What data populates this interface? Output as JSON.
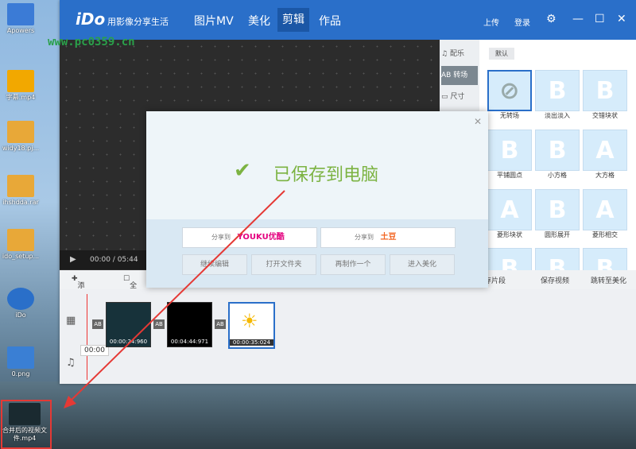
{
  "watermark": "www.pc0359.cn",
  "desktop": {
    "icons": [
      {
        "label": "Apowers",
        "color": "#3b7bd6"
      },
      {
        "label": "字幕.mp4",
        "color": "#f2a800"
      },
      {
        "label": "widy18.pj...",
        "color": "#e8a838"
      },
      {
        "label": "ihshdda.rar",
        "color": "#e8a838"
      },
      {
        "label": "ido_setup...",
        "color": "#e8a838"
      },
      {
        "label": "iDo",
        "color": "#2a6fc9"
      },
      {
        "label": "0.png",
        "color": "#3a7fd4"
      }
    ],
    "highlighted_file": {
      "label": "合并后的视频文件.mp4"
    }
  },
  "app": {
    "logo": "iDo",
    "slogan": "用影像分享生活",
    "tabs": [
      {
        "label": "图片MV",
        "active": false
      },
      {
        "label": "美化",
        "active": false
      },
      {
        "label": "剪辑",
        "active": true
      },
      {
        "label": "作品",
        "active": false
      }
    ],
    "upload": "上传",
    "login": "登录"
  },
  "player": {
    "time": "00:00 / 05:44"
  },
  "side_tools": [
    {
      "label": "配乐",
      "icon": "music-icon",
      "active": false
    },
    {
      "label": "转场",
      "icon": "ab-icon",
      "active": true
    },
    {
      "label": "尺寸",
      "icon": "screen-icon",
      "active": false
    }
  ],
  "transitions": {
    "header": "默认",
    "items": [
      {
        "label": "无转场",
        "glyph": "⊘"
      },
      {
        "label": "淡出淡入",
        "glyph": "B"
      },
      {
        "label": "交错块状",
        "glyph": "B"
      },
      {
        "label": "平铺圆点",
        "glyph": "B"
      },
      {
        "label": "小方格",
        "glyph": "B"
      },
      {
        "label": "大方格",
        "glyph": "A"
      },
      {
        "label": "菱形块状",
        "glyph": "A"
      },
      {
        "label": "圆形展开",
        "glyph": "B"
      },
      {
        "label": "菱形相交",
        "glyph": "A"
      },
      {
        "label": "",
        "glyph": "B"
      },
      {
        "label": "",
        "glyph": "B"
      },
      {
        "label": "",
        "glyph": "B"
      }
    ]
  },
  "toolbar": {
    "add": "添加",
    "select_all": "全选",
    "save_clip": "保存片段",
    "save_video": "保存视频",
    "goto_beautify": "跳转至美化"
  },
  "timeline": {
    "clips": [
      {
        "time": "00:00:24:960"
      },
      {
        "time": "00:04:44:971"
      },
      {
        "time": "00:00:35:024"
      }
    ],
    "transition_label": "AB",
    "audio_time": "00:00"
  },
  "dialog": {
    "message": "已保存到电脑",
    "share1": {
      "prefix": "分享到",
      "brand": "YOUKU优酷"
    },
    "share2": {
      "prefix": "分享到",
      "brand": "土豆"
    },
    "actions": [
      "继续编辑",
      "打开文件夹",
      "再制作一个",
      "进入美化"
    ]
  }
}
